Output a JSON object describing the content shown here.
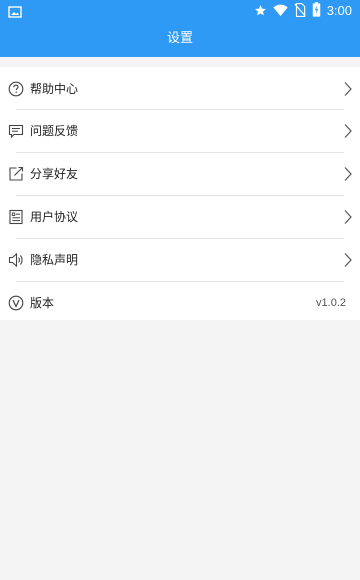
{
  "status_bar": {
    "time": "3:00",
    "icons": [
      "image-icon",
      "star-icon",
      "wifi-icon",
      "no-sim-icon",
      "battery-icon"
    ]
  },
  "header": {
    "title": "设置",
    "background_color": "#2e9af5"
  },
  "settings": {
    "items": [
      {
        "label": "帮助中心",
        "icon": "help-icon"
      },
      {
        "label": "问题反馈",
        "icon": "feedback-icon"
      },
      {
        "label": "分享好友",
        "icon": "share-icon"
      },
      {
        "label": "用户协议",
        "icon": "agreement-icon"
      },
      {
        "label": "隐私声明",
        "icon": "privacy-icon"
      }
    ],
    "version": {
      "label": "版本",
      "icon": "version-icon",
      "value": "v1.0.2"
    }
  }
}
